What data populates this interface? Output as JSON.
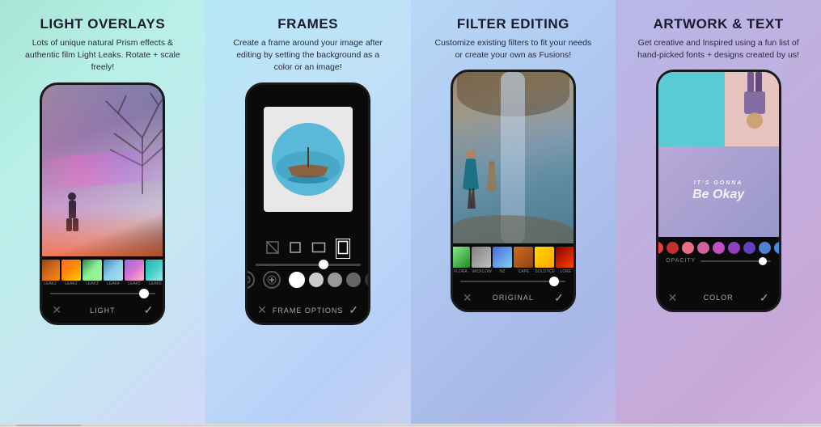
{
  "panels": [
    {
      "id": "panel-1",
      "title": "LIGHT OVERLAYS",
      "description": "Lots of unique natural Prism effects & authentic film Light Leaks. Rotate + scale freely!",
      "phone": {
        "film_labels": [
          "LEAK1",
          "LEAK2",
          "LEAK3",
          "LEAK4",
          "LEAK5",
          "LEAK6"
        ],
        "bottom_label": "LIGHT"
      }
    },
    {
      "id": "panel-2",
      "title": "FRAMES",
      "description": "Create a frame around your image after editing by setting the background as a color or an image!",
      "phone": {
        "bottom_label": "FRAME OPTIONS",
        "color_dots": [
          "#ffffff",
          "#dddddd",
          "#aaaaaa",
          "#777777",
          "#444444"
        ]
      }
    },
    {
      "id": "panel-3",
      "title": "FILTER EDITING",
      "description": "Customize existing filters to fit your needs or create your own as Fusions!",
      "phone": {
        "filter_labels": [
          "FLORA",
          "WICKLOW",
          "NZ",
          "CAPE",
          "SOLSTICE",
          "LORE"
        ],
        "bottom_label": "ORIGINAL"
      }
    },
    {
      "id": "panel-4",
      "title": "ARTWORK & TEXT",
      "description": "Get creative and Inspired using a fun list of hand-picked fonts + designs created by us!",
      "phone": {
        "artwork_text_line1": "IT'S GONNA",
        "artwork_text_line2": "Be Okay",
        "bottom_label": "COLOR",
        "opacity_label": "OPACITY",
        "colors": [
          "#e84040",
          "#c03030",
          "#e87080",
          "#d060a0",
          "#c050c0",
          "#9040c0",
          "#6040c0",
          "#5080d0",
          "#4090e0"
        ]
      }
    }
  ],
  "bottom_x": "✕",
  "bottom_check": "✓"
}
